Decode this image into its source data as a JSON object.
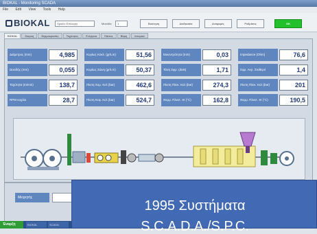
{
  "window": {
    "title": "BIOKAL - Monitoring SCADA"
  },
  "menu": {
    "items": [
      "File",
      "Edit",
      "View",
      "Tools",
      "Help"
    ]
  },
  "header": {
    "logo": "BIOKAL",
    "combo_product": "Προϊόν Επιλογής",
    "combo_label": "Μονάδα",
    "combo_unit": "1",
    "buttons": [
      "Εκκίνηση",
      "Διαδικασία",
      "Αναφορές",
      "Ρυθμίσεις",
      "OK"
    ]
  },
  "tabs": [
    "BIOKAL",
    "Εισροή",
    "Θερμοκρασίες",
    "Ταχύτητες",
    "Ενέργεια",
    "Πιέσεις",
    "Βάρη",
    "Ιστορικό"
  ],
  "readings": [
    {
      "label": "Διάμετρος (mm)",
      "value": "4,985"
    },
    {
      "label": "Ωοειδής (mm)",
      "value": "0,055"
    },
    {
      "label": "Ταχύτητα (m/min)",
      "value": "138,7"
    },
    {
      "label": "RPM κοχλία",
      "value": "28,7"
    },
    {
      "label": "Κυρίως Κύκλ. (gr/Lm)",
      "value": "51,56"
    },
    {
      "label": "Κυρίως Ζώνη (gr/Lm)",
      "value": "50,37"
    },
    {
      "label": "Πίεση Χυμ. Κελ (bar)",
      "value": "462,6"
    },
    {
      "label": "Πίεση Κεφ. Κελ (bar)",
      "value": "524,7"
    },
    {
      "label": "Εκκεντρότητα (mm)",
      "value": "0,03"
    },
    {
      "label": "Τάση Σφρ. (daN)",
      "value": "1,71"
    },
    {
      "label": "Πίεση Πλεκ. Κελ (bar)",
      "value": "274,3"
    },
    {
      "label": "Θερμ. Πλεκτ. ΧΙ (°C)",
      "value": "162,8"
    },
    {
      "label": "Impedance (Ohm)",
      "value": "76,6"
    },
    {
      "label": "Σφρ. Ακρ. Σταθερό",
      "value": "1,4"
    },
    {
      "label": "Πίεση Πλεκ. Κελ (bar)",
      "value": "201"
    },
    {
      "label": "Θερμ. Πλεκτ. ΧΙ (°C)",
      "value": "190,5"
    }
  ],
  "bottom": {
    "label": "Μετρητής"
  },
  "taskbar": {
    "start": "Έναρξη",
    "tasks": [
      "BIOKAL",
      "SCADA"
    ]
  },
  "overlay": {
    "line1": "1995 Συστήματα",
    "line2": "S.C.A.D.A./S.P.C."
  },
  "colors": {
    "label_bg": "#5f86bf",
    "value_text": "#233a78",
    "ok_button": "#22c02a",
    "overlay_bg": "#4169b4"
  }
}
